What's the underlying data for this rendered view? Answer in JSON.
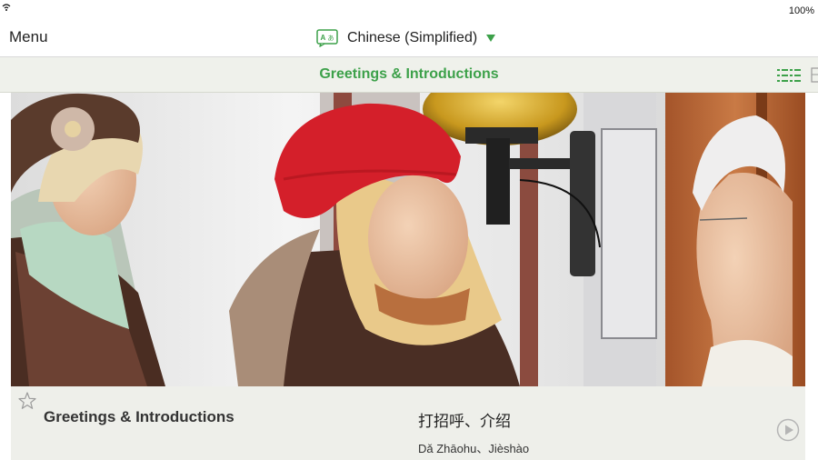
{
  "status_bar": {
    "battery": "100%",
    "icons": [
      "wifi-icon"
    ]
  },
  "header": {
    "menu_label": "Menu",
    "language_label": "Chinese (Simplified)",
    "language_icon": "translate-icon",
    "dropdown_icon": "triangle-down-icon"
  },
  "section": {
    "title": "Greetings & Introductions",
    "view_icons": [
      "list-view-icon",
      "grid-view-icon"
    ]
  },
  "lesson_card": {
    "title": "Greetings & Introductions",
    "chinese": "打招呼、介绍",
    "pinyin": "Dǎ Zhāohu、Jièshào",
    "icons": [
      "star-icon",
      "play-icon"
    ]
  },
  "colors": {
    "accent_green": "#3da14a",
    "titlebar_bg": "#eff1eb",
    "card_bg": "#eeefea"
  }
}
